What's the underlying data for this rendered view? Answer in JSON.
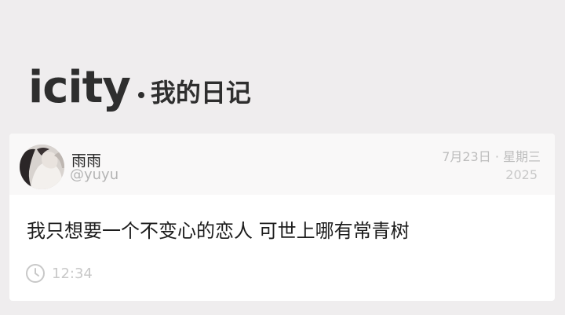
{
  "header": {
    "logo": "icity",
    "subtitle": "我的日记"
  },
  "post": {
    "username": "雨雨",
    "handle": "@yuyu",
    "date": "7月23日 · 星期三",
    "year": "2025",
    "content": "我只想要一个不变心的恋人 可世上哪有常青树",
    "time": "12:34"
  },
  "icons": {
    "avatar": "user-avatar",
    "clock": "clock-icon"
  },
  "colors": {
    "background": "#efedee",
    "card": "#ffffff",
    "card_header": "#f9f8f8",
    "muted_text": "#c8c8c8"
  }
}
